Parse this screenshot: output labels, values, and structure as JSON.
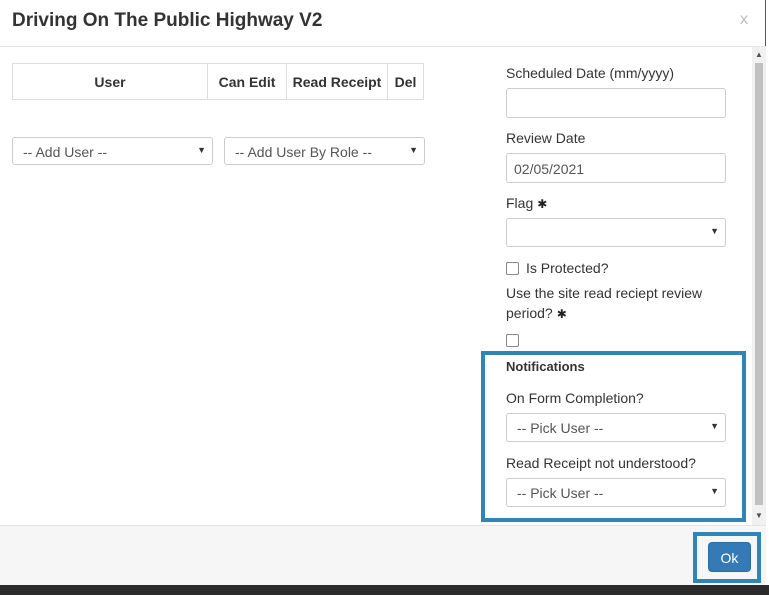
{
  "modal": {
    "title": "Driving On The Public Highway V2",
    "close_label": "x"
  },
  "user_table": {
    "headers": [
      "User",
      "Can Edit",
      "Read Receipt",
      "Del"
    ]
  },
  "add_user": {
    "selected": "-- Add User --"
  },
  "add_user_by_role": {
    "selected": "-- Add User By Role --"
  },
  "scheduled_date": {
    "label": "Scheduled Date (mm/yyyy)",
    "value": ""
  },
  "review_date": {
    "label": "Review Date",
    "value": "02/05/2021"
  },
  "flag": {
    "label": "Flag",
    "required_icon": "asterisk-icon",
    "selected": ""
  },
  "is_protected": {
    "label": "Is Protected?",
    "checked": false
  },
  "site_read_receipt": {
    "label": "Use the site read reciept review period?",
    "required_icon": "asterisk-icon",
    "checked": false
  },
  "notifications": {
    "heading": "Notifications",
    "on_form_completion": {
      "label": "On Form Completion?",
      "selected": "-- Pick User --"
    },
    "read_receipt_not_understood": {
      "label": "Read Receipt not understood?",
      "selected": "-- Pick User --"
    }
  },
  "footer": {
    "ok_label": "Ok"
  },
  "colors": {
    "highlight": "#2f86b6",
    "primary_button": "#337ab7"
  }
}
